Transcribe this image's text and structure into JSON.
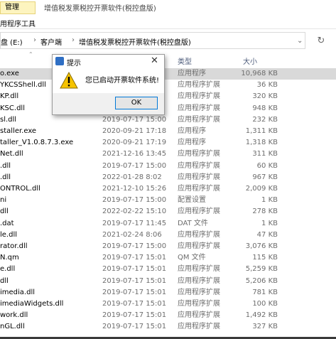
{
  "window": {
    "manage_tab": "管理",
    "title": "增值税发票税控开票软件(税控盘版)",
    "ribbon_tab": "用程序工具"
  },
  "address": {
    "crumbs": [
      "盘 (E:)",
      "客户端",
      "增值税发票税控开票软件(税控盘版)"
    ]
  },
  "columns": {
    "type": "类型",
    "size": "大小"
  },
  "files": [
    {
      "name": "o.exe",
      "date": "",
      "type": "应用程序",
      "size": "10,968 KB",
      "selected": true
    },
    {
      "name": "YKCSShell.dll",
      "date": "",
      "type": "应用程序扩展",
      "size": "36 KB"
    },
    {
      "name": "KP.dll",
      "date": "",
      "type": "应用程序扩展",
      "size": "320 KB"
    },
    {
      "name": "KSC.dll",
      "date": "",
      "type": "应用程序扩展",
      "size": "948 KB"
    },
    {
      "name": "sl.dll",
      "date": "2019-07-17 15:00",
      "type": "应用程序扩展",
      "size": "232 KB"
    },
    {
      "name": "staller.exe",
      "date": "2020-09-21 17:18",
      "type": "应用程序",
      "size": "1,311 KB"
    },
    {
      "name": "taller_V1.0.8.7.3.exe",
      "date": "2020-09-21 17:19",
      "type": "应用程序",
      "size": "1,318 KB"
    },
    {
      "name": "Net.dll",
      "date": "2021-12-16 13:45",
      "type": "应用程序扩展",
      "size": "311 KB"
    },
    {
      "name": ".dll",
      "date": "2019-07-17 15:00",
      "type": "应用程序扩展",
      "size": "60 KB"
    },
    {
      "name": ".dll",
      "date": "2022-01-28 8:02",
      "type": "应用程序扩展",
      "size": "967 KB"
    },
    {
      "name": "ONTROL.dll",
      "date": "2021-12-10 15:26",
      "type": "应用程序扩展",
      "size": "2,009 KB"
    },
    {
      "name": "ni",
      "date": "2019-07-17 15:00",
      "type": "配置设置",
      "size": "1 KB"
    },
    {
      "name": "dll",
      "date": "2022-02-22 15:10",
      "type": "应用程序扩展",
      "size": "278 KB"
    },
    {
      "name": ".dat",
      "date": "2019-07-17 11:45",
      "type": "DAT 文件",
      "size": "1 KB"
    },
    {
      "name": "le.dll",
      "date": "2021-02-24 8:06",
      "type": "应用程序扩展",
      "size": "47 KB"
    },
    {
      "name": "rator.dll",
      "date": "2019-07-17 15:00",
      "type": "应用程序扩展",
      "size": "3,076 KB"
    },
    {
      "name": "N.qm",
      "date": "2019-07-17 15:01",
      "type": "QM 文件",
      "size": "115 KB"
    },
    {
      "name": "e.dll",
      "date": "2019-07-17 15:01",
      "type": "应用程序扩展",
      "size": "5,259 KB"
    },
    {
      "name": "dll",
      "date": "2019-07-17 15:01",
      "type": "应用程序扩展",
      "size": "5,206 KB"
    },
    {
      "name": "imedia.dll",
      "date": "2019-07-17 15:01",
      "type": "应用程序扩展",
      "size": "781 KB"
    },
    {
      "name": "imediaWidgets.dll",
      "date": "2019-07-17 15:01",
      "type": "应用程序扩展",
      "size": "100 KB"
    },
    {
      "name": "work.dll",
      "date": "2019-07-17 15:01",
      "type": "应用程序扩展",
      "size": "1,492 KB"
    },
    {
      "name": "nGL.dll",
      "date": "2019-07-17 15:01",
      "type": "应用程序扩展",
      "size": "327 KB"
    }
  ],
  "dialog": {
    "title": "提示",
    "close": "✕",
    "message": "您已启动开票软件系统!",
    "ok_label": "OK"
  }
}
